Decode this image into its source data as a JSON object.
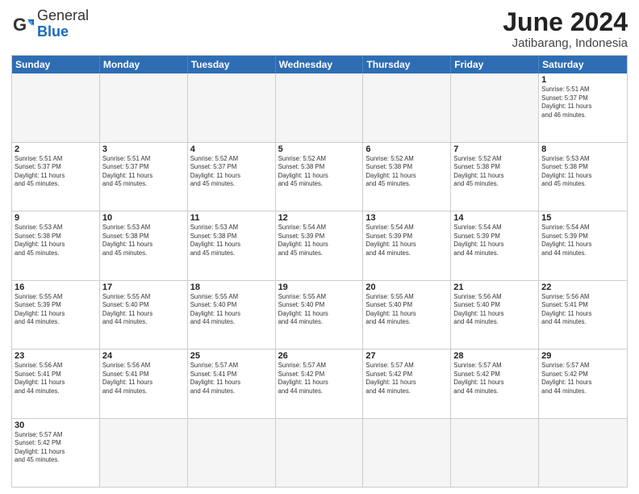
{
  "logo": {
    "text_general": "General",
    "text_blue": "Blue"
  },
  "title": "June 2024",
  "subtitle": "Jatibarang, Indonesia",
  "header_days": [
    "Sunday",
    "Monday",
    "Tuesday",
    "Wednesday",
    "Thursday",
    "Friday",
    "Saturday"
  ],
  "weeks": [
    [
      {
        "day": "",
        "info": "",
        "empty": true
      },
      {
        "day": "",
        "info": "",
        "empty": true
      },
      {
        "day": "",
        "info": "",
        "empty": true
      },
      {
        "day": "",
        "info": "",
        "empty": true
      },
      {
        "day": "",
        "info": "",
        "empty": true
      },
      {
        "day": "",
        "info": "",
        "empty": true
      },
      {
        "day": "1",
        "info": "Sunrise: 5:51 AM\nSunset: 5:37 PM\nDaylight: 11 hours\nand 46 minutes."
      }
    ],
    [
      {
        "day": "2",
        "info": "Sunrise: 5:51 AM\nSunset: 5:37 PM\nDaylight: 11 hours\nand 45 minutes."
      },
      {
        "day": "3",
        "info": "Sunrise: 5:51 AM\nSunset: 5:37 PM\nDaylight: 11 hours\nand 45 minutes."
      },
      {
        "day": "4",
        "info": "Sunrise: 5:52 AM\nSunset: 5:37 PM\nDaylight: 11 hours\nand 45 minutes."
      },
      {
        "day": "5",
        "info": "Sunrise: 5:52 AM\nSunset: 5:38 PM\nDaylight: 11 hours\nand 45 minutes."
      },
      {
        "day": "6",
        "info": "Sunrise: 5:52 AM\nSunset: 5:38 PM\nDaylight: 11 hours\nand 45 minutes."
      },
      {
        "day": "7",
        "info": "Sunrise: 5:52 AM\nSunset: 5:38 PM\nDaylight: 11 hours\nand 45 minutes."
      },
      {
        "day": "8",
        "info": "Sunrise: 5:53 AM\nSunset: 5:38 PM\nDaylight: 11 hours\nand 45 minutes."
      }
    ],
    [
      {
        "day": "9",
        "info": "Sunrise: 5:53 AM\nSunset: 5:38 PM\nDaylight: 11 hours\nand 45 minutes."
      },
      {
        "day": "10",
        "info": "Sunrise: 5:53 AM\nSunset: 5:38 PM\nDaylight: 11 hours\nand 45 minutes."
      },
      {
        "day": "11",
        "info": "Sunrise: 5:53 AM\nSunset: 5:38 PM\nDaylight: 11 hours\nand 45 minutes."
      },
      {
        "day": "12",
        "info": "Sunrise: 5:54 AM\nSunset: 5:39 PM\nDaylight: 11 hours\nand 45 minutes."
      },
      {
        "day": "13",
        "info": "Sunrise: 5:54 AM\nSunset: 5:39 PM\nDaylight: 11 hours\nand 44 minutes."
      },
      {
        "day": "14",
        "info": "Sunrise: 5:54 AM\nSunset: 5:39 PM\nDaylight: 11 hours\nand 44 minutes."
      },
      {
        "day": "15",
        "info": "Sunrise: 5:54 AM\nSunset: 5:39 PM\nDaylight: 11 hours\nand 44 minutes."
      }
    ],
    [
      {
        "day": "16",
        "info": "Sunrise: 5:55 AM\nSunset: 5:39 PM\nDaylight: 11 hours\nand 44 minutes."
      },
      {
        "day": "17",
        "info": "Sunrise: 5:55 AM\nSunset: 5:40 PM\nDaylight: 11 hours\nand 44 minutes."
      },
      {
        "day": "18",
        "info": "Sunrise: 5:55 AM\nSunset: 5:40 PM\nDaylight: 11 hours\nand 44 minutes."
      },
      {
        "day": "19",
        "info": "Sunrise: 5:55 AM\nSunset: 5:40 PM\nDaylight: 11 hours\nand 44 minutes."
      },
      {
        "day": "20",
        "info": "Sunrise: 5:55 AM\nSunset: 5:40 PM\nDaylight: 11 hours\nand 44 minutes."
      },
      {
        "day": "21",
        "info": "Sunrise: 5:56 AM\nSunset: 5:40 PM\nDaylight: 11 hours\nand 44 minutes."
      },
      {
        "day": "22",
        "info": "Sunrise: 5:56 AM\nSunset: 5:41 PM\nDaylight: 11 hours\nand 44 minutes."
      }
    ],
    [
      {
        "day": "23",
        "info": "Sunrise: 5:56 AM\nSunset: 5:41 PM\nDaylight: 11 hours\nand 44 minutes."
      },
      {
        "day": "24",
        "info": "Sunrise: 5:56 AM\nSunset: 5:41 PM\nDaylight: 11 hours\nand 44 minutes."
      },
      {
        "day": "25",
        "info": "Sunrise: 5:57 AM\nSunset: 5:41 PM\nDaylight: 11 hours\nand 44 minutes."
      },
      {
        "day": "26",
        "info": "Sunrise: 5:57 AM\nSunset: 5:42 PM\nDaylight: 11 hours\nand 44 minutes."
      },
      {
        "day": "27",
        "info": "Sunrise: 5:57 AM\nSunset: 5:42 PM\nDaylight: 11 hours\nand 44 minutes."
      },
      {
        "day": "28",
        "info": "Sunrise: 5:57 AM\nSunset: 5:42 PM\nDaylight: 11 hours\nand 44 minutes."
      },
      {
        "day": "29",
        "info": "Sunrise: 5:57 AM\nSunset: 5:42 PM\nDaylight: 11 hours\nand 44 minutes."
      }
    ],
    [
      {
        "day": "30",
        "info": "Sunrise: 5:57 AM\nSunset: 5:42 PM\nDaylight: 11 hours\nand 45 minutes."
      },
      {
        "day": "",
        "info": "",
        "empty": true
      },
      {
        "day": "",
        "info": "",
        "empty": true
      },
      {
        "day": "",
        "info": "",
        "empty": true
      },
      {
        "day": "",
        "info": "",
        "empty": true
      },
      {
        "day": "",
        "info": "",
        "empty": true
      },
      {
        "day": "",
        "info": "",
        "empty": true
      }
    ]
  ]
}
